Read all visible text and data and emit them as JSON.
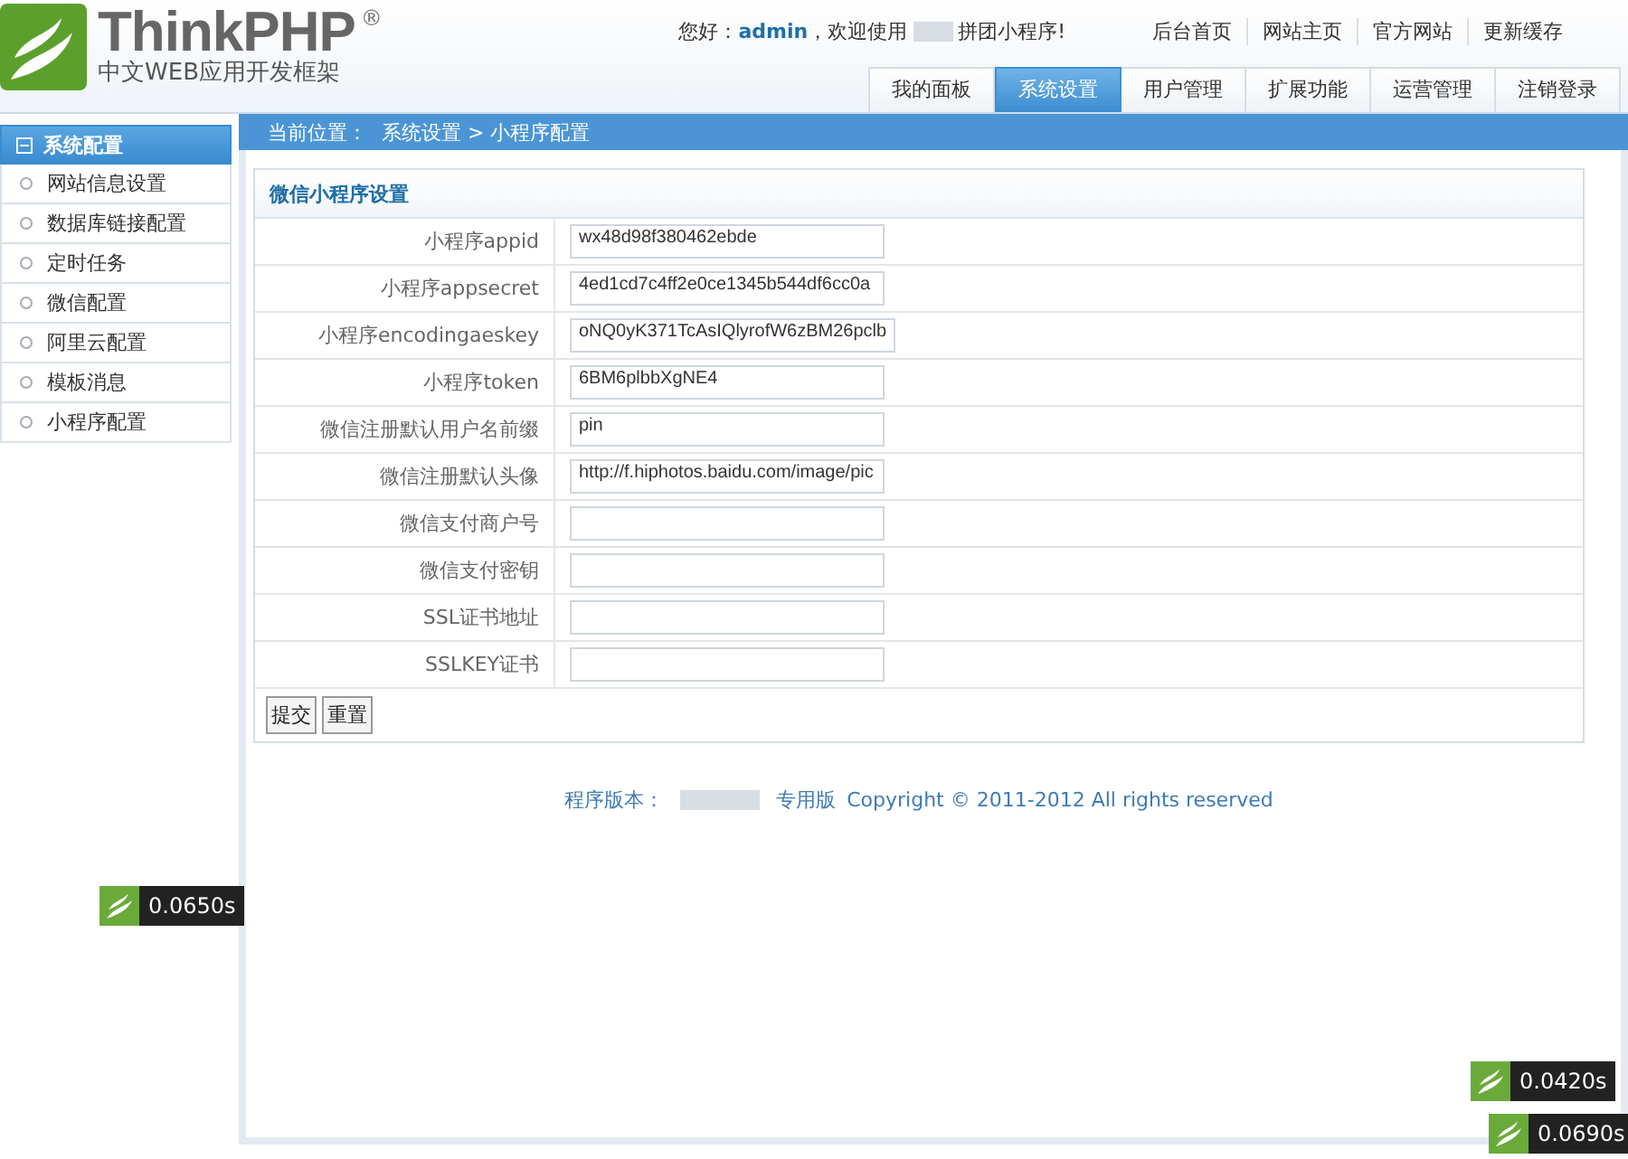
{
  "logo": {
    "name": "ThinkPHP",
    "mark": "®",
    "tagline": "中文WEB应用开发框架"
  },
  "greeting": {
    "hello": "您好：",
    "user": "admin",
    "welcome": "，欢迎使用",
    "app": "拼团小程序!"
  },
  "top_links": [
    "后台首页",
    "网站主页",
    "官方网站",
    "更新缓存"
  ],
  "tabs": [
    {
      "label": "我的面板",
      "selected": false
    },
    {
      "label": "系统设置",
      "selected": true
    },
    {
      "label": "用户管理",
      "selected": false
    },
    {
      "label": "扩展功能",
      "selected": false
    },
    {
      "label": "运营管理",
      "selected": false
    },
    {
      "label": "注销登录",
      "selected": false
    }
  ],
  "sidebar": {
    "title": "系统配置",
    "expanded": true,
    "items": [
      {
        "label": "网站信息设置",
        "selected": false
      },
      {
        "label": "数据库链接配置",
        "selected": false
      },
      {
        "label": "定时任务",
        "selected": false
      },
      {
        "label": "微信配置",
        "selected": false
      },
      {
        "label": "阿里云配置",
        "selected": false
      },
      {
        "label": "模板消息",
        "selected": false
      },
      {
        "label": "小程序配置",
        "selected": false
      }
    ]
  },
  "breadcrumb": {
    "prefix": "当前位置：",
    "path": "系统设置 > 小程序配置"
  },
  "form": {
    "title": "微信小程序设置",
    "fields": [
      {
        "label": "小程序appid",
        "value": "wx48d98f380462ebde"
      },
      {
        "label": "小程序appsecret",
        "value": "4ed1cd7c4ff2e0ce1345b544df6cc0a"
      },
      {
        "label": "小程序encodingaeskey",
        "value": "oNQ0yK371TcAsIQlyrofW6zBM26pclb"
      },
      {
        "label": "小程序token",
        "value": "6BM6plbbXgNE4"
      },
      {
        "label": "微信注册默认用户名前缀",
        "value": "pin"
      },
      {
        "label": "微信注册默认头像",
        "value": "http://f.hiphotos.baidu.com/image/pic"
      },
      {
        "label": "微信支付商户号"
      },
      {
        "label": "微信支付密钥"
      },
      {
        "label": "SSL证书地址"
      },
      {
        "label": "SSLKEY证书"
      }
    ],
    "buttons": [
      "提交",
      "重置"
    ]
  },
  "footer": {
    "version_label": "程序版本：",
    "edition": "专用版",
    "copyright": "Copyright © 2011-2012 All rights reserved"
  },
  "timers": [
    "0.0650s",
    "0.0420s",
    "0.0690s"
  ]
}
